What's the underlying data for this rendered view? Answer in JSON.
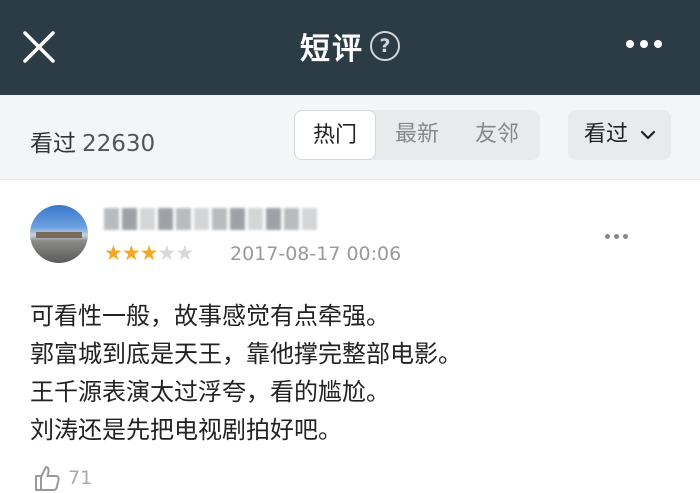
{
  "header": {
    "title": "短评",
    "help_glyph": "?",
    "close_icon": "close-icon",
    "more_icon": "more-horizontal-icon"
  },
  "filter": {
    "seen_label": "看过",
    "seen_count": "22630",
    "tabs": [
      {
        "label": "热门",
        "active": true
      },
      {
        "label": "最新",
        "active": false
      },
      {
        "label": "友邻",
        "active": false
      }
    ],
    "dropdown_label": "看过"
  },
  "review": {
    "rating": 3,
    "rating_max": 5,
    "date": "2017-08-17 00:06",
    "lines": [
      "可看性一般，故事感觉有点牵强。",
      "郭富城到底是天王，靠他撑完整部电影。",
      "王千源表演太过浮夸，看的尴尬。",
      "刘涛还是先把电视剧拍好吧。"
    ],
    "likes": "71"
  },
  "colors": {
    "header_bg": "#2b3c46",
    "star_on": "#f5a623",
    "star_off": "#d6d8da"
  }
}
